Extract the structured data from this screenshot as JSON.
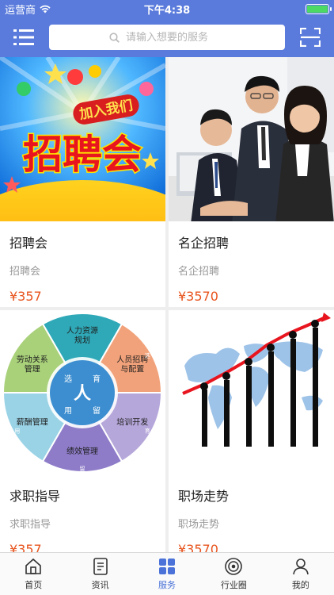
{
  "status": {
    "carrier": "运营商",
    "time": "下午4:38"
  },
  "search": {
    "placeholder": "请输入想要的服务"
  },
  "cards": [
    {
      "title": "招聘会",
      "subtitle": "招聘会",
      "price": "¥357",
      "banner_text": "招聘会",
      "banner_badge": "加入我们"
    },
    {
      "title": "名企招聘",
      "subtitle": "名企招聘",
      "price": "¥3570"
    },
    {
      "title": "求职指导",
      "subtitle": "求职指导",
      "price": "¥357",
      "wheel": {
        "center_letters": [
          "选",
          "育",
          "用",
          "留"
        ],
        "center_mark": "人",
        "segments": [
          "人力资源\n规划",
          "人员招聘\n与配置",
          "培训开发",
          "绩效管理",
          "薪酬管理",
          "劳动关系\n管理"
        ],
        "ring_labels": [
          "选",
          "育",
          "留",
          "用"
        ]
      }
    },
    {
      "title": "职场走势",
      "subtitle": "职场走势",
      "price": "¥3570"
    }
  ],
  "tabs": [
    {
      "label": "首页",
      "icon": "home-icon",
      "active": false
    },
    {
      "label": "资讯",
      "icon": "news-icon",
      "active": false
    },
    {
      "label": "服务",
      "icon": "grid-icon",
      "active": true
    },
    {
      "label": "行业圈",
      "icon": "circle-icon",
      "active": false
    },
    {
      "label": "我的",
      "icon": "user-icon",
      "active": false
    }
  ],
  "colors": {
    "brand": "#5a7bdc",
    "price": "#e8541e",
    "tab_active": "#4a72d8"
  }
}
